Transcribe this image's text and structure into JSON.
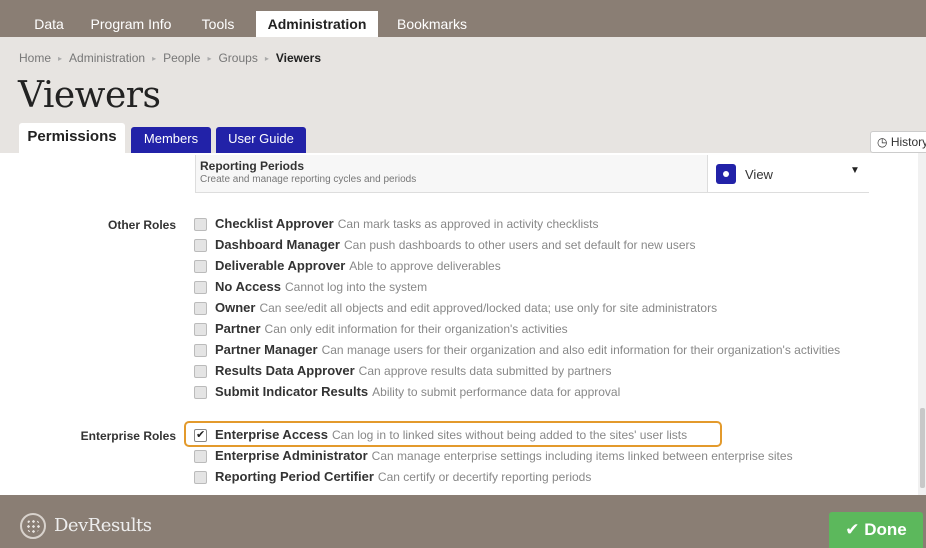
{
  "topnav": {
    "tabs": [
      {
        "label": "Data"
      },
      {
        "label": "Program Info"
      },
      {
        "label": "Tools"
      },
      {
        "label": "Administration"
      },
      {
        "label": "Bookmarks"
      }
    ],
    "active": "Administration"
  },
  "breadcrumb": [
    "Home",
    "Administration",
    "People",
    "Groups",
    "Viewers"
  ],
  "page_title": "Viewers",
  "subtabs": [
    {
      "label": "Permissions"
    },
    {
      "label": "Members"
    },
    {
      "label": "User Guide"
    }
  ],
  "history_label": "History",
  "reporting_periods": {
    "title": "Reporting Periods",
    "description": "Create and manage reporting cycles and periods",
    "permission": "View"
  },
  "other_roles": {
    "label": "Other Roles",
    "items": [
      {
        "name": "Checklist Approver",
        "desc": "Can mark tasks as approved in activity checklists",
        "checked": false
      },
      {
        "name": "Dashboard Manager",
        "desc": "Can push dashboards to other users and set default for new users",
        "checked": false
      },
      {
        "name": "Deliverable Approver",
        "desc": "Able to approve deliverables",
        "checked": false
      },
      {
        "name": "No Access",
        "desc": "Cannot log into the system",
        "checked": false
      },
      {
        "name": "Owner",
        "desc": "Can see/edit all objects and edit approved/locked data; use only for site administrators",
        "checked": false
      },
      {
        "name": "Partner",
        "desc": "Can only edit information for their organization's activities",
        "checked": false
      },
      {
        "name": "Partner Manager",
        "desc": "Can manage users for their organization and also edit information for their organization's activities",
        "checked": false
      },
      {
        "name": "Results Data Approver",
        "desc": "Can approve results data submitted by partners",
        "checked": false
      },
      {
        "name": "Submit Indicator Results",
        "desc": "Ability to submit performance data for approval",
        "checked": false
      }
    ]
  },
  "enterprise_roles": {
    "label": "Enterprise Roles",
    "items": [
      {
        "name": "Enterprise Access",
        "desc": "Can log in to linked sites without being added to the sites' user lists",
        "checked": true
      },
      {
        "name": "Enterprise Administrator",
        "desc": "Can manage enterprise settings including items linked between enterprise sites",
        "checked": false
      },
      {
        "name": "Reporting Period Certifier",
        "desc": "Can certify or decertify reporting periods",
        "checked": false
      }
    ]
  },
  "footer": {
    "logo_text": "DevResults",
    "done_label": "Done"
  },
  "colors": {
    "nav_bg": "#8a7e74",
    "header_bg": "#e7e4e1",
    "accent_blue": "#2222a8",
    "done_green": "#5cb85c",
    "highlight": "#e39a2c"
  }
}
